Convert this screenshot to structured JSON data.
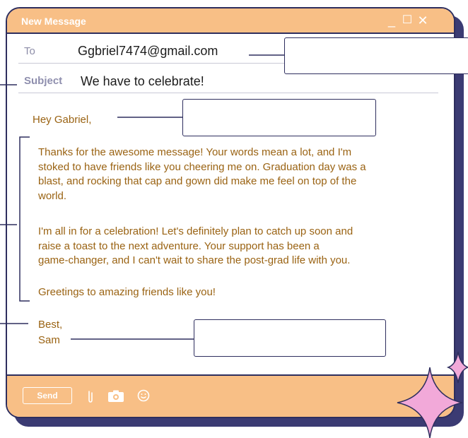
{
  "window": {
    "title": "New Message"
  },
  "controls": {
    "minimize": "_",
    "maximize": "☐",
    "close": "✕"
  },
  "fields": {
    "to_label": "To",
    "to_value": "Ggbriel7474@gmail.com",
    "subject_label": "Subject",
    "subject_value": "We have to celebrate!"
  },
  "message": {
    "greeting": "Hey Gabriel,",
    "para1_lines": [
      "Thanks for the awesome message! Your words mean a lot, and I'm",
      "stoked to have friends like you cheering me on. Graduation day was a",
      "blast, and rocking that cap and gown did make me feel on top of the",
      "world."
    ],
    "para2_lines": [
      "I'm all in for a celebration! Let's definitely plan to catch up soon and",
      "raise a toast to the next adventure. Your support has been a",
      "game-changer, and I can't wait to share the post-grad life with you."
    ],
    "para3": "Greetings to amazing friends like you!",
    "closing": "Best,",
    "signature": "Sam"
  },
  "footer": {
    "send_label": "Send"
  },
  "colors": {
    "accent": "#f8bf86",
    "outline": "#2e2e5e",
    "body_text": "#9a6313",
    "sparkle": "#f2a9d9"
  },
  "icons": [
    "paperclip-icon",
    "camera-icon",
    "emoji-icon",
    "sparkle-icon"
  ]
}
